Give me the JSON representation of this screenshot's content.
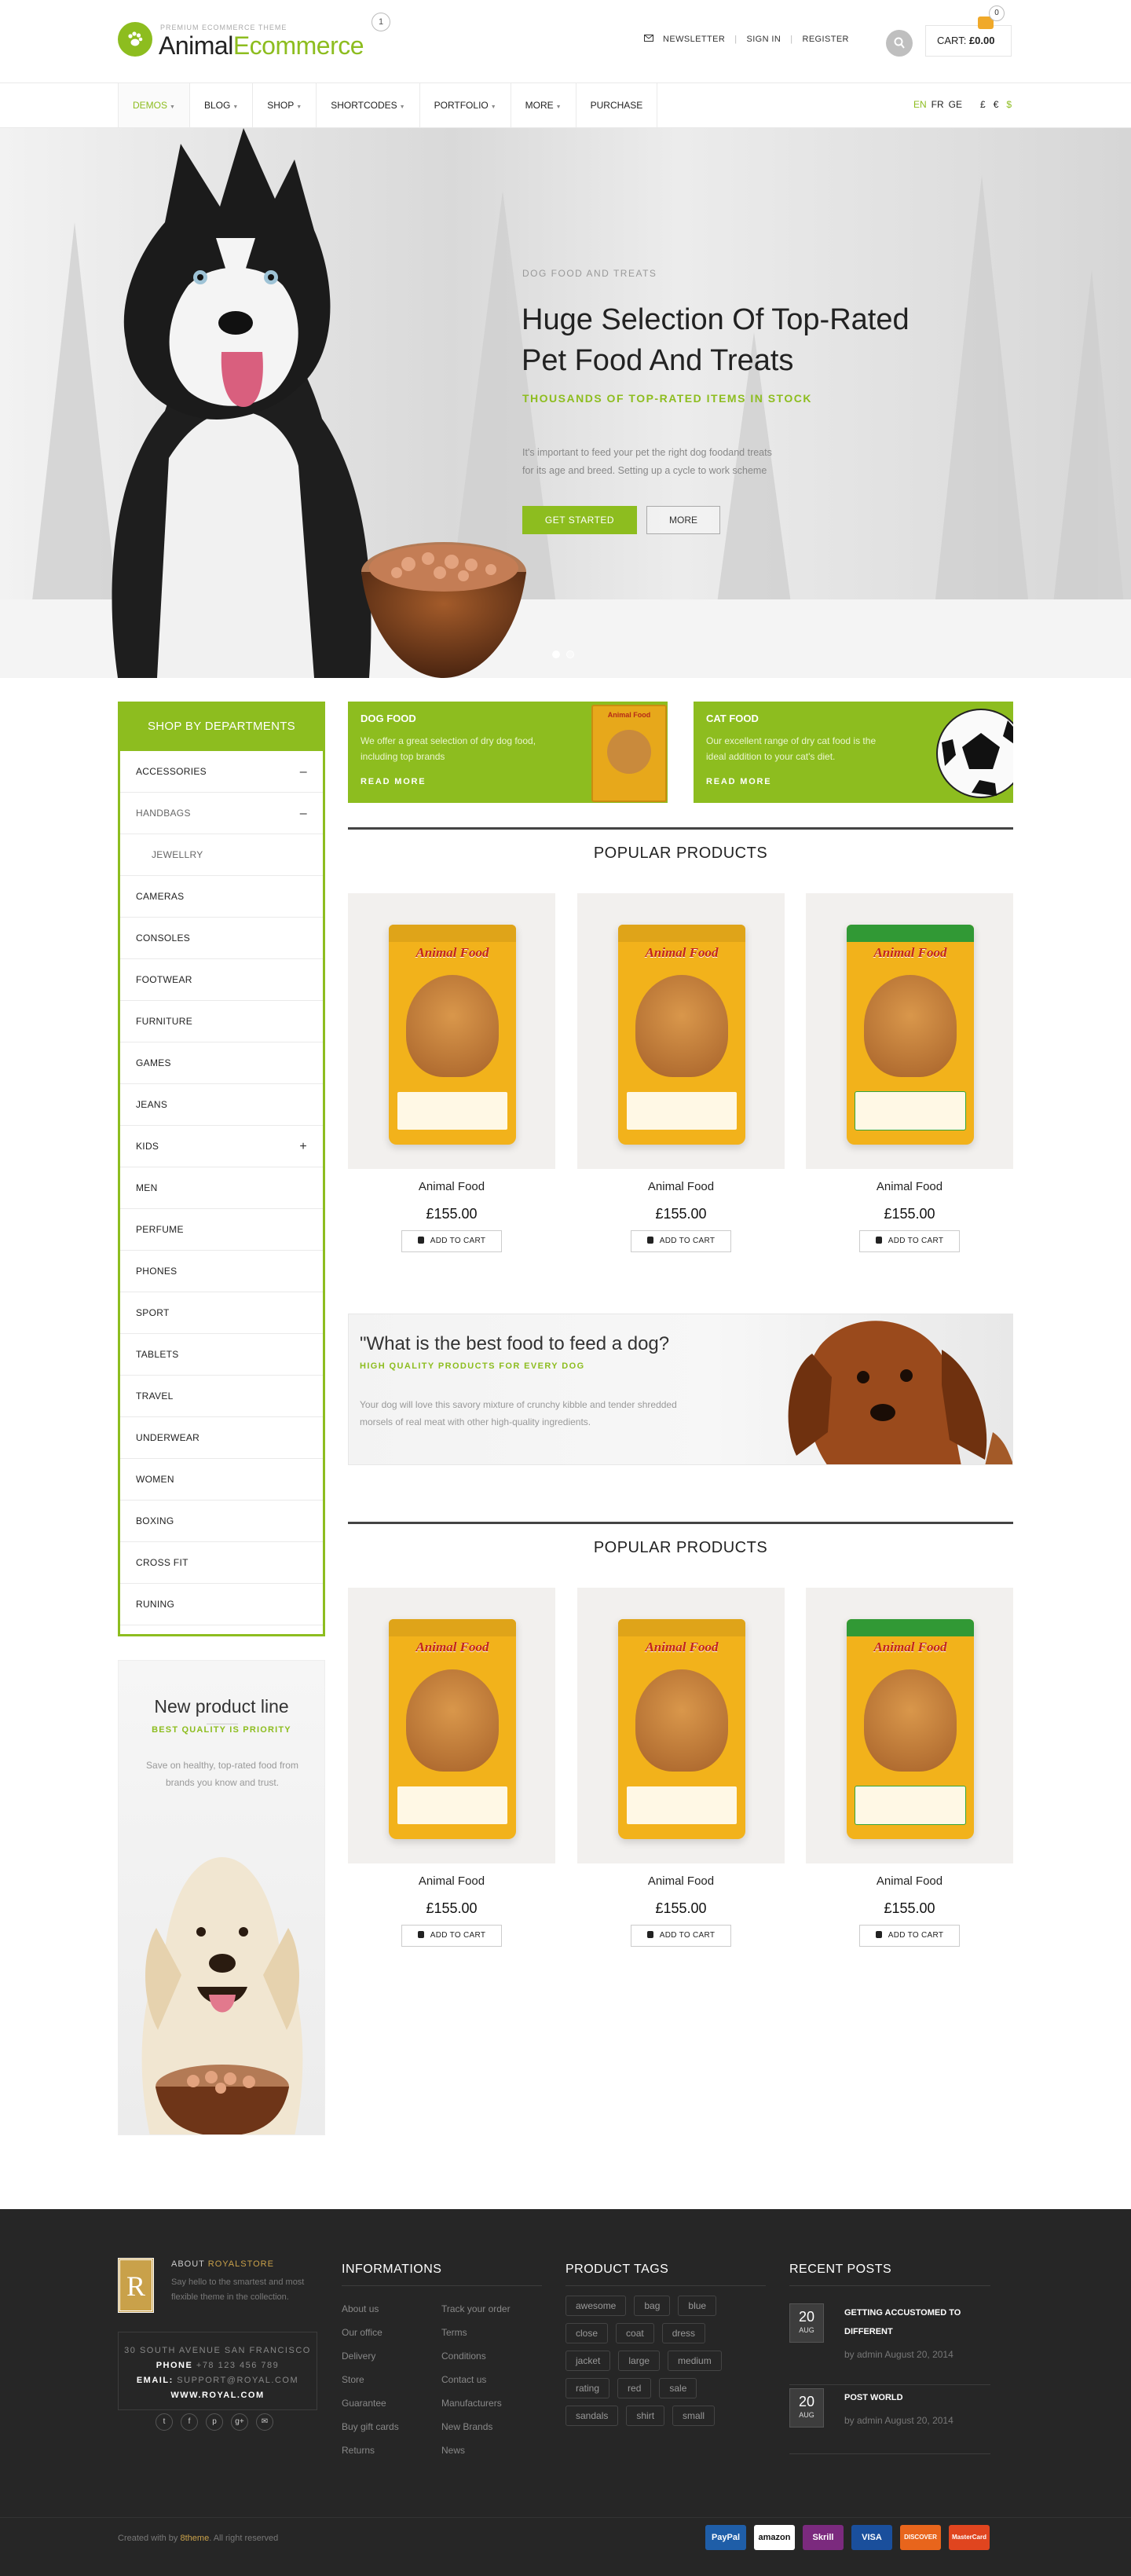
{
  "header": {
    "logo_tagline": "PREMIUM ECOMMERCE THEME",
    "logo_part1": "Animal",
    "logo_part2": "Ecommerce",
    "logo_badge": "1",
    "links": [
      "NEWSLETTER",
      "SIGN IN",
      "REGISTER"
    ],
    "cart_label": "CART:",
    "cart_total": "£0.00",
    "cart_count": "0"
  },
  "nav": {
    "items": [
      {
        "label": "DEMOS",
        "dropdown": true
      },
      {
        "label": "BLOG",
        "dropdown": true
      },
      {
        "label": "SHOP",
        "dropdown": true
      },
      {
        "label": "SHORTCODES",
        "dropdown": true
      },
      {
        "label": "PORTFOLIO",
        "dropdown": true
      },
      {
        "label": "MORE",
        "dropdown": true
      },
      {
        "label": "PURCHASE",
        "dropdown": false
      }
    ],
    "languages": [
      "EN",
      "FR",
      "GE"
    ],
    "currencies": [
      "£",
      "€",
      "$"
    ]
  },
  "hero": {
    "eyebrow": "DOG FOOD AND TREATS",
    "title_line1": "Huge Selection Of Top-Rated",
    "title_line2": "Pet Food And Treats",
    "subtitle": "THOUSANDS OF TOP-RATED ITEMS IN STOCK",
    "text_line1": "It's important to feed your pet the right dog foodand treats",
    "text_line2": "for its age and breed. Setting up a cycle to work scheme",
    "primary_button": "GET STARTED",
    "secondary_button": "MORE"
  },
  "departments": {
    "title": "SHOP BY DEPARTMENTS",
    "items": [
      {
        "label": "ACCESSORIES",
        "toggle": "–"
      },
      {
        "label": "HANDBAGS",
        "toggle": "–"
      },
      {
        "label": "JEWELLRY",
        "toggle": ""
      },
      {
        "label": "CAMERAS",
        "toggle": ""
      },
      {
        "label": "CONSOLES",
        "toggle": ""
      },
      {
        "label": "FOOTWEAR",
        "toggle": ""
      },
      {
        "label": "FURNITURE",
        "toggle": ""
      },
      {
        "label": "GAMES",
        "toggle": ""
      },
      {
        "label": "JEANS",
        "toggle": ""
      },
      {
        "label": "KIDS",
        "toggle": "+"
      },
      {
        "label": "MEN",
        "toggle": ""
      },
      {
        "label": "PERFUME",
        "toggle": ""
      },
      {
        "label": "PHONES",
        "toggle": ""
      },
      {
        "label": "SPORT",
        "toggle": ""
      },
      {
        "label": "TABLETS",
        "toggle": ""
      },
      {
        "label": "TRAVEL",
        "toggle": ""
      },
      {
        "label": "UNDERWEAR",
        "toggle": ""
      },
      {
        "label": "WOMEN",
        "toggle": ""
      },
      {
        "label": "BOXING",
        "toggle": ""
      },
      {
        "label": "CROSS FIT",
        "toggle": ""
      },
      {
        "label": "RUNING",
        "toggle": ""
      }
    ]
  },
  "promo": {
    "title": "New product line",
    "subtitle": "BEST QUALITY IS PRIORITY",
    "text": "Save on healthy, top-rated food from brands you know and trust."
  },
  "banners": [
    {
      "title": "DOG FOOD",
      "text": "We offer a great selection of dry dog food, including top brands",
      "more": "READ MORE",
      "pack_label": "Animal Food"
    },
    {
      "title": "CAT FOOD",
      "text": "Our excellent range of dry cat food is the ideal addition to your cat's diet.",
      "more": "READ MORE"
    }
  ],
  "sections": [
    {
      "title": "POPULAR PRODUCTS"
    },
    {
      "title": "POPULAR PRODUCTS"
    }
  ],
  "products": [
    {
      "name": "Animal Food",
      "price": "£155.00",
      "button": "ADD TO CART",
      "pack_label": "Animal Food",
      "pack_color": "#f2b21b",
      "accent": "#f2b21b"
    },
    {
      "name": "Animal Food",
      "price": "£155.00",
      "button": "ADD TO CART",
      "pack_label": "Animal Food",
      "pack_color": "#f2b21b",
      "accent": "#f2b21b"
    },
    {
      "name": "Animal Food",
      "price": "£155.00",
      "button": "ADD TO CART",
      "pack_label": "Animal Food",
      "pack_color": "#f2b21b",
      "accent": "#35a63a"
    },
    {
      "name": "Animal Food",
      "price": "£155.00",
      "button": "ADD TO CART",
      "pack_label": "Animal Food",
      "pack_color": "#f2b21b",
      "accent": "#f2b21b"
    },
    {
      "name": "Animal Food",
      "price": "£155.00",
      "button": "ADD TO CART",
      "pack_label": "Animal Food",
      "pack_color": "#f2b21b",
      "accent": "#f2b21b"
    },
    {
      "name": "Animal Food",
      "price": "£155.00",
      "button": "ADD TO CART",
      "pack_label": "Animal Food",
      "pack_color": "#f2b21b",
      "accent": "#35a63a"
    }
  ],
  "question_banner": {
    "title": "\"What is the best food to feed a dog?",
    "subtitle": "HIGH QUALITY PRODUCTS FOR EVERY DOG",
    "text": "Your dog will love this savory mixture of crunchy kibble and tender shredded morsels of real meat with other high-quality ingredients."
  },
  "footer": {
    "logo_letter": "R",
    "about_title_prefix": "ABOUT",
    "about_title_brand": "ROYALSTORE",
    "about_text": "Say hello to the smartest and most flexible theme in the collection.",
    "address": "30 SOUTH AVENUE SAN FRANCISCO",
    "phone_label": "PHONE",
    "phone": "+78 123 456 789",
    "email_label": "EMAIL:",
    "email": "SUPPORT@ROYAL.COM",
    "website": "WWW.ROYAL.COM",
    "social": [
      "t",
      "f",
      "p",
      "g+",
      "✉"
    ],
    "informations_title": "INFORMATIONS",
    "info_col1": [
      "About us",
      "Our office",
      "Delivery",
      "Store",
      "Guarantee",
      "Buy gift cards",
      "Returns"
    ],
    "info_col2": [
      "Track your order",
      "Terms",
      "Conditions",
      "Contact us",
      "Manufacturers",
      "New Brands",
      "News"
    ],
    "tags_title": "PRODUCT TAGS",
    "tags": [
      "awesome",
      "bag",
      "blue",
      "close",
      "coat",
      "dress",
      "jacket",
      "large",
      "medium",
      "rating",
      "red",
      "sale",
      "sandals",
      "shirt",
      "small"
    ],
    "posts_title": "RECENT POSTS",
    "posts": [
      {
        "day": "20",
        "month": "AUG",
        "title": "GETTING ACCUSTOMED TO DIFFERENT",
        "meta": "by admin August 20, 2014"
      },
      {
        "day": "20",
        "month": "AUG",
        "title": "POST WORLD",
        "meta": "by admin August 20, 2014"
      }
    ],
    "credit_prefix": "Created with by",
    "credit_brand": "8theme",
    "credit_suffix": ". All right reserved",
    "payments": [
      {
        "label": "PayPal",
        "color": "#1f5ea8"
      },
      {
        "label": "amazon",
        "color": "#ffffff"
      },
      {
        "label": "Skrill",
        "color": "#7b2a7e"
      },
      {
        "label": "VISA",
        "color": "#1a4f9c"
      },
      {
        "label": "DISCOVER",
        "color": "#e8651c"
      },
      {
        "label": "MasterCard",
        "color": "#e0451f"
      }
    ]
  }
}
